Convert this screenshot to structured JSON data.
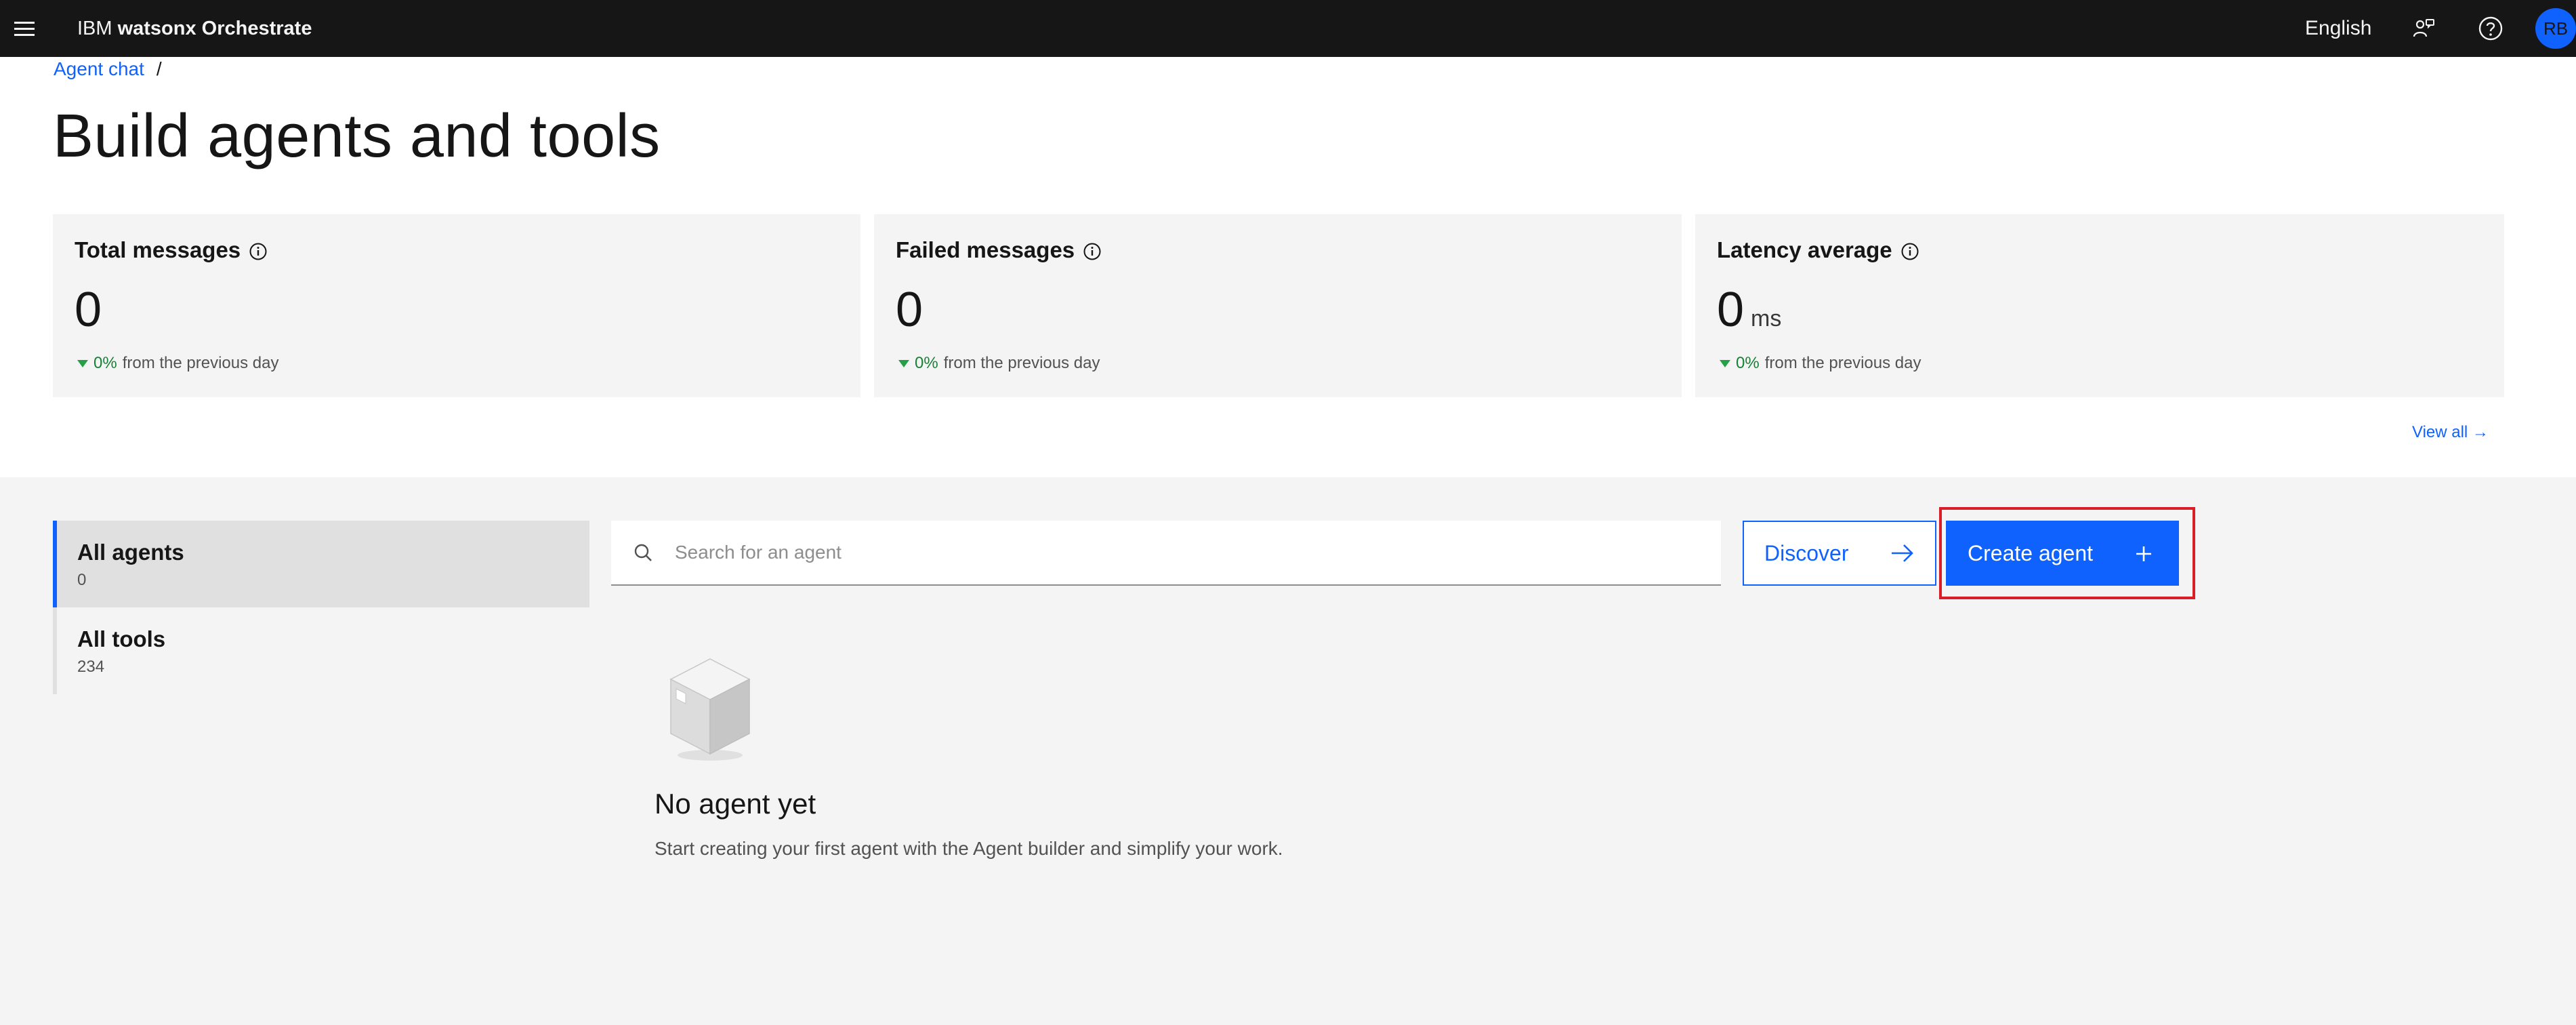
{
  "header": {
    "brand_prefix": "IBM",
    "brand_product": "watsonx Orchestrate",
    "language": "English",
    "avatar_initials": "RB",
    "icons": [
      "menu-icon",
      "agent-chat-icon",
      "help-icon"
    ]
  },
  "breadcrumb": {
    "link": "Agent chat",
    "separator": "/"
  },
  "page": {
    "title": "Build agents and tools"
  },
  "metrics": [
    {
      "label": "Total messages",
      "value": "0",
      "unit": "",
      "trend_pct": "0%",
      "trend_text": "from the previous day"
    },
    {
      "label": "Failed messages",
      "value": "0",
      "unit": "",
      "trend_pct": "0%",
      "trend_text": "from the previous day"
    },
    {
      "label": "Latency average",
      "value": "0",
      "unit": "ms",
      "trend_pct": "0%",
      "trend_text": "from the previous day"
    }
  ],
  "view_all": "View all →",
  "sidebar": {
    "items": [
      {
        "label": "All agents",
        "count": "0",
        "active": true
      },
      {
        "label": "All tools",
        "count": "234",
        "active": false
      }
    ]
  },
  "search": {
    "placeholder": "Search for an agent",
    "value": ""
  },
  "buttons": {
    "discover": "Discover",
    "create_agent": "Create agent"
  },
  "empty_state": {
    "title": "No agent yet",
    "description": "Start creating your first agent with the Agent builder and simplify your work."
  },
  "colors": {
    "header_bg": "#161616",
    "primary": "#0f62fe",
    "highlight": "#da1e28",
    "trend_green": "#24a148",
    "page_bg": "#f4f4f4"
  }
}
